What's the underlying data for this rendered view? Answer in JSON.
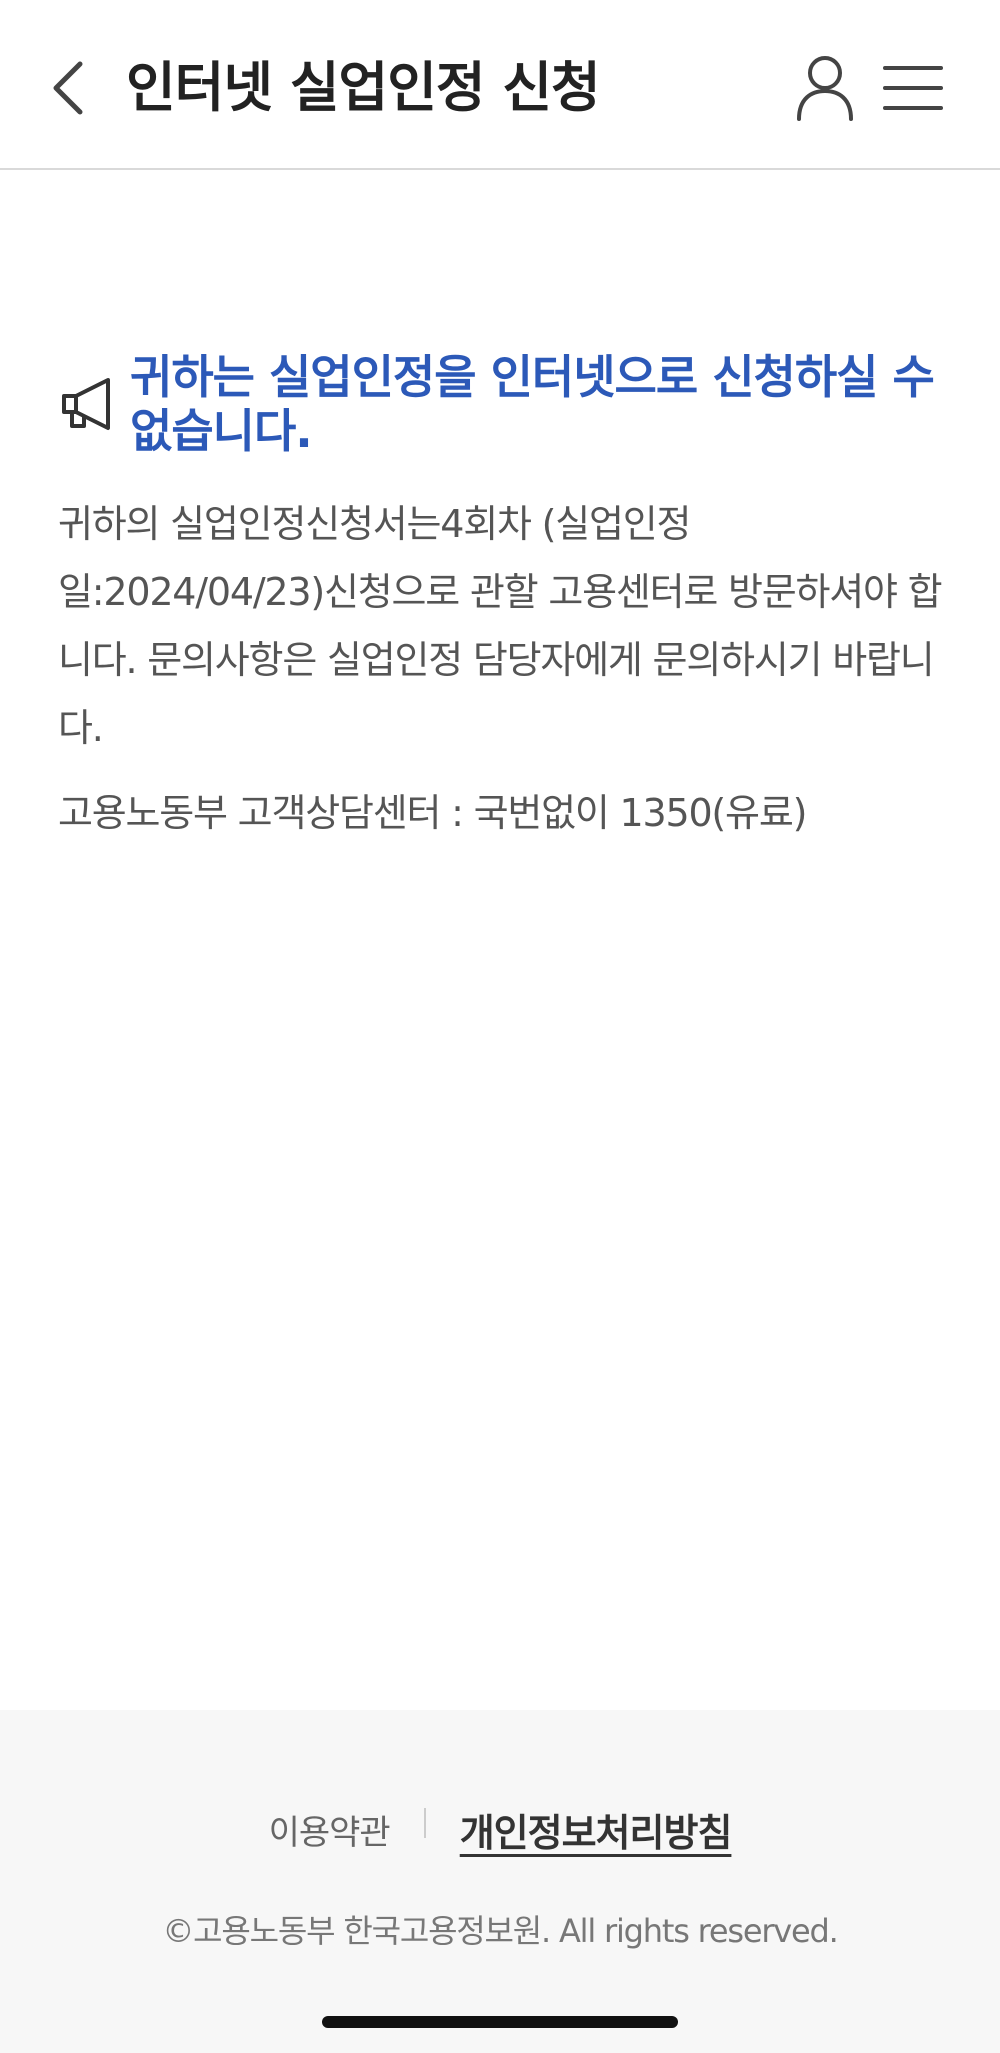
{
  "header": {
    "title": "인터넷 실업인정 신청",
    "back_icon": "chevron-left-icon",
    "user_icon": "user-icon",
    "menu_icon": "hamburger-menu-icon"
  },
  "notice": {
    "icon": "megaphone-icon",
    "title": "귀하는 실업인정을 인터넷으로 신청하실 수 없습니다.",
    "body": "귀하의 실업인정신청서는4회차 (실업인정일:2024/04/23)신청으로 관할 고용센터로 방문하셔야 합니다. 문의사항은 실업인정 담당자에게 문의하시기 바랍니다.",
    "contact": "고용노동부 고객상담센터 : 국번없이 1350(유료)"
  },
  "footer": {
    "terms_label": "이용약관",
    "privacy_label": "개인정보처리방침",
    "copyright": "©고용노동부 한국고용정보원. All rights reserved."
  },
  "colors": {
    "accent": "#2c59b8",
    "text": "#222222",
    "body_text": "#555555",
    "footer_bg": "#f7f7f7"
  }
}
